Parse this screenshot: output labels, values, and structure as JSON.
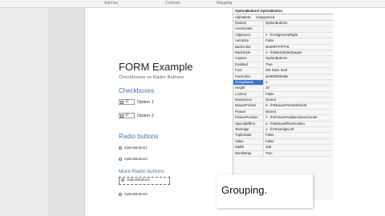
{
  "ribbon": {
    "groups": [
      "Add-ins",
      "Controls",
      "Mapping"
    ]
  },
  "document": {
    "title": "FORM Example",
    "subtitle": "Checkboxes vs Radio Buttons",
    "checkboxes_heading": "Checkboxes",
    "checkboxes": [
      "Option 1",
      "Option 2"
    ],
    "radio_heading": "Radio buttons",
    "radios": [
      "OptionButton1",
      "OptionButton2"
    ],
    "more_radio_heading": "More Radio buttons",
    "more_radios": [
      "OptionButton3",
      "OptionButton4"
    ]
  },
  "properties": {
    "object": "OptionButton3  OptionButton",
    "tabs": [
      "Alphabetic",
      "Categorized"
    ],
    "rows": [
      {
        "name": "(Name)",
        "value": "OptionButton3"
      },
      {
        "name": "Accelerator",
        "value": ""
      },
      {
        "name": "Alignment",
        "value": "1 - fmAlignmentRight"
      },
      {
        "name": "AutoSize",
        "value": "False"
      },
      {
        "name": "BackColor",
        "value": "&H00FFFFFF&"
      },
      {
        "name": "BackStyle",
        "value": "1 - fmBackStyleOpaque"
      },
      {
        "name": "Caption",
        "value": "OptionButton3"
      },
      {
        "name": "Enabled",
        "value": "True"
      },
      {
        "name": "Font",
        "value": "MS Sans Serif"
      },
      {
        "name": "ForeColor",
        "value": "&H80000008&"
      },
      {
        "name": "GroupName",
        "value": "2"
      },
      {
        "name": "Height",
        "value": "18"
      },
      {
        "name": "Locked",
        "value": "False"
      },
      {
        "name": "MouseIcon",
        "value": "(None)"
      },
      {
        "name": "MousePointer",
        "value": "0 - fmMousePointerDefault"
      },
      {
        "name": "Picture",
        "value": "(None)"
      },
      {
        "name": "PicturePosition",
        "value": "7 - fmPicturePositionAboveCenter"
      },
      {
        "name": "SpecialEffect",
        "value": "2 - fmButtonEffectSunken"
      },
      {
        "name": "TextAlign",
        "value": "1 - fmTextAlignLeft"
      },
      {
        "name": "TripleState",
        "value": "False"
      },
      {
        "name": "Value",
        "value": "False"
      },
      {
        "name": "Width",
        "value": "108"
      },
      {
        "name": "WordWrap",
        "value": "True"
      }
    ]
  },
  "caption_overlay": "Grouping."
}
